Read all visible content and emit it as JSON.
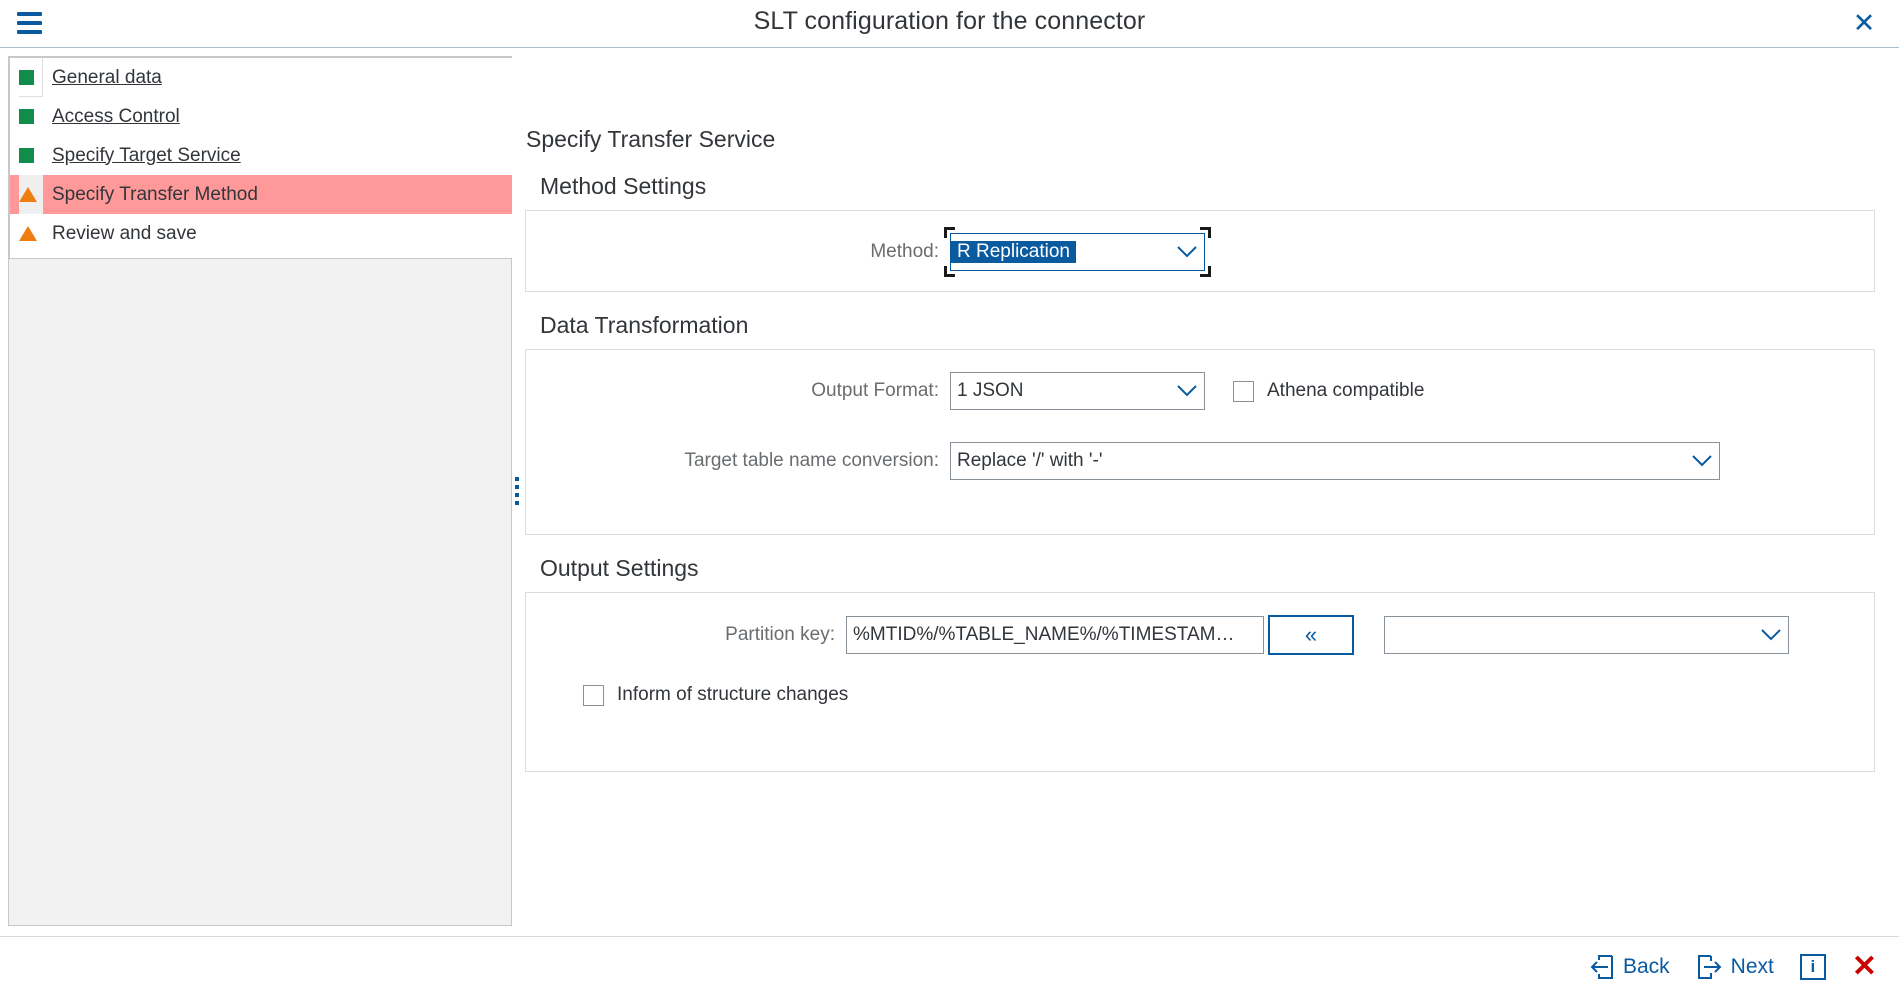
{
  "window": {
    "title": "SLT configuration for the connector",
    "menu_icon": "hamburger-menu-icon",
    "close_icon": "close-icon"
  },
  "sidebar": {
    "items": [
      {
        "label": "General data",
        "status": "done",
        "status_icon": "green-square-icon"
      },
      {
        "label": "Access Control",
        "status": "done",
        "status_icon": "green-square-icon"
      },
      {
        "label": "Specify Target  Service",
        "status": "done",
        "status_icon": "green-square-icon"
      },
      {
        "label": "Specify Transfer Method",
        "status": "current",
        "status_icon": "orange-warning-triangle-icon"
      },
      {
        "label": "Review and save",
        "status": "warning",
        "status_icon": "orange-warning-triangle-icon"
      }
    ]
  },
  "main": {
    "page_title": "Specify Transfer Service",
    "sections": {
      "method_settings": {
        "title": "Method Settings",
        "method_label": "Method:",
        "method_value": "R Replication"
      },
      "data_transformation": {
        "title": "Data Transformation",
        "output_format_label": "Output Format:",
        "output_format_value": "1 JSON",
        "athena_label": "Athena compatible",
        "athena_checked": false,
        "conversion_label": "Target table name conversion:",
        "conversion_value": "Replace '/' with '-'"
      },
      "output_settings": {
        "title": "Output Settings",
        "partition_key_label": "Partition key:",
        "partition_key_value": "%MTID%/%TABLE_NAME%/%TIMESTAM…",
        "insert_button_label": "«",
        "token_select_value": "",
        "inform_label": "Inform of structure changes",
        "inform_checked": false
      }
    }
  },
  "footer": {
    "back_label": "Back",
    "next_label": "Next",
    "info_label": "i",
    "cancel_icon": "red-close-icon"
  },
  "colors": {
    "accent": "#0a5aa0",
    "done": "#128c4b",
    "warning": "#ef7d10",
    "current_row": "#ff9999",
    "danger": "#cc0000"
  }
}
